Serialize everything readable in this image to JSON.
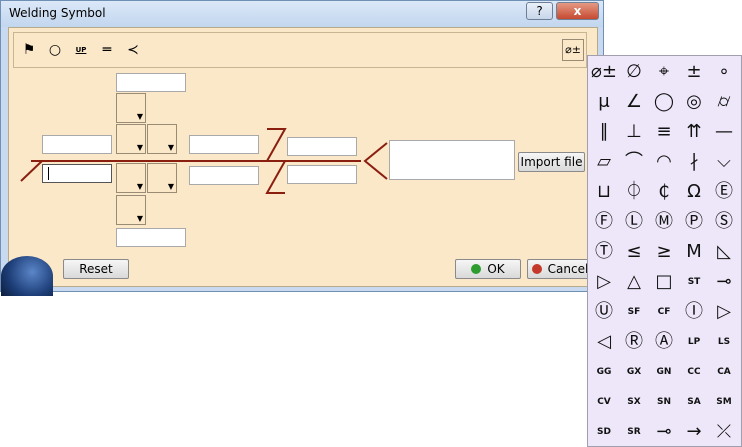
{
  "window": {
    "title": "Welding Symbol",
    "help": "?",
    "close": "x"
  },
  "toolbar": {
    "items": [
      "⚑",
      "○",
      "UP",
      "═",
      "≺"
    ],
    "right_icon": "⌀±"
  },
  "form": {
    "import_label": "Import file",
    "reset_label": "Reset",
    "ok_label": "OK",
    "cancel_label": "Cancel",
    "ok_color": "#2e9c2e",
    "cancel_color": "#c43a2a",
    "line_color": "#8a1f10"
  },
  "palette": {
    "rows": [
      [
        "⌀±",
        "∅",
        "⌖",
        "±",
        "∘"
      ],
      [
        "μ",
        "∠",
        "◯",
        "◎",
        "⌭"
      ],
      [
        "∥",
        "⊥",
        "≡",
        "⇈",
        "—"
      ],
      [
        "▱",
        "⌒",
        "◠",
        "∤",
        "⌵"
      ],
      [
        "⊔",
        "⏀",
        "₵",
        "Ω",
        "Ⓔ"
      ],
      [
        "Ⓕ",
        "Ⓛ",
        "Ⓜ",
        "Ⓟ",
        "Ⓢ"
      ],
      [
        "Ⓣ",
        "≤",
        "≥",
        "M",
        "◺"
      ],
      [
        "▷",
        "△",
        "□",
        "ST",
        "⊸"
      ],
      [
        "Ⓤ",
        "SF",
        "CF",
        "Ⓘ",
        "▷"
      ],
      [
        "◁",
        "Ⓡ",
        "Ⓐ",
        "LP",
        "LS"
      ],
      [
        "GG",
        "GX",
        "GN",
        "CC",
        "CA"
      ],
      [
        "CV",
        "SX",
        "SN",
        "SA",
        "SM"
      ],
      [
        "SD",
        "SR",
        "⊸",
        "→",
        "⤫"
      ]
    ]
  }
}
